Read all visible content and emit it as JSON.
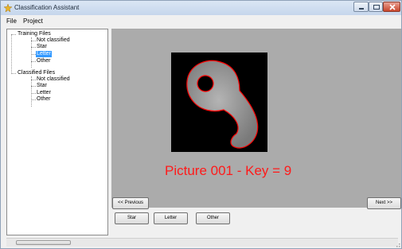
{
  "window": {
    "title": "Classification Assistant"
  },
  "menu": {
    "file": "File",
    "project": "Project"
  },
  "tree": {
    "training": {
      "label": "Training Files",
      "children": [
        "Not classified",
        "Star",
        "Letter",
        "Other"
      ],
      "selected": "Letter"
    },
    "classified": {
      "label": "Classified Files",
      "children": [
        "Not classified",
        "Star",
        "Letter",
        "Other"
      ]
    }
  },
  "viewer": {
    "caption": "Picture 001 - Key = 9",
    "caption_color": "#ff1a1a",
    "background": "#ababab"
  },
  "nav": {
    "previous": "<< Previous",
    "next": "Next >>"
  },
  "classify_buttons": {
    "star": "Star",
    "letter": "Letter",
    "other": "Other"
  },
  "colors": {
    "selection": "#3399ff",
    "close_button": "#c9462c",
    "outline": "#ff0000"
  }
}
